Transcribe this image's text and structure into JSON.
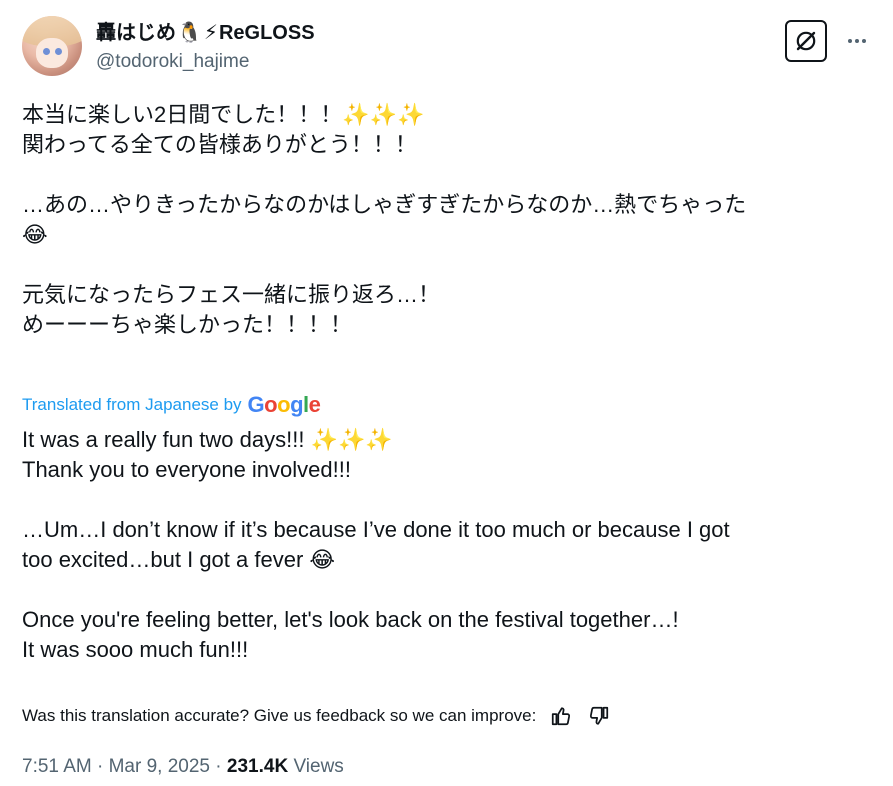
{
  "author": {
    "display_name": "轟はじめ",
    "display_name_emoji_1": "🐧",
    "display_name_emoji_2": "⚡",
    "display_name_suffix": "ReGLOSS",
    "handle": "@todoroki_hajime",
    "avatar_icon": "avatar-image"
  },
  "actions": {
    "grok_icon": "grok-icon",
    "more_label": "···"
  },
  "tweet": {
    "lines": [
      "本当に楽しい2日間でした！！！✨✨✨",
      "関わってる全ての皆様ありがとう！！！",
      "",
      "…あの…やりきったからなのかはしゃぎすぎたからなのか…熱でちゃった",
      "😂",
      "",
      "元気になったらフェス一緒に振り返ろ…！",
      "めーーーちゃ楽しかった！！！！"
    ]
  },
  "translation": {
    "label": "Translated from Japanese by",
    "provider": "Google",
    "lines": [
      "It was a really fun two days!!! ✨✨✨",
      "Thank you to everyone involved!!!",
      "",
      "…Um…I don’t know if it’s because I’ve done it too much or because I got",
      "too excited…but I got a fever 😂",
      "",
      "Once you're feeling better, let's look back on the festival together…!",
      "It was sooo much fun!!!"
    ],
    "feedback_prompt": "Was this translation accurate? Give us feedback so we can improve:",
    "thumbs_up_icon": "thumbs-up-icon",
    "thumbs_down_icon": "thumbs-down-icon"
  },
  "meta": {
    "time": "7:51 AM",
    "separator": " · ",
    "date": "Mar 9, 2025",
    "views_count": "231.4K",
    "views_label": " Views"
  },
  "colors": {
    "link_blue": "#1d9bf0",
    "secondary_text": "#536471",
    "primary_text": "#0f1419",
    "google_blue": "#4285F4",
    "google_red": "#EA4335",
    "google_yellow": "#FBBC05",
    "google_green": "#34A853"
  }
}
